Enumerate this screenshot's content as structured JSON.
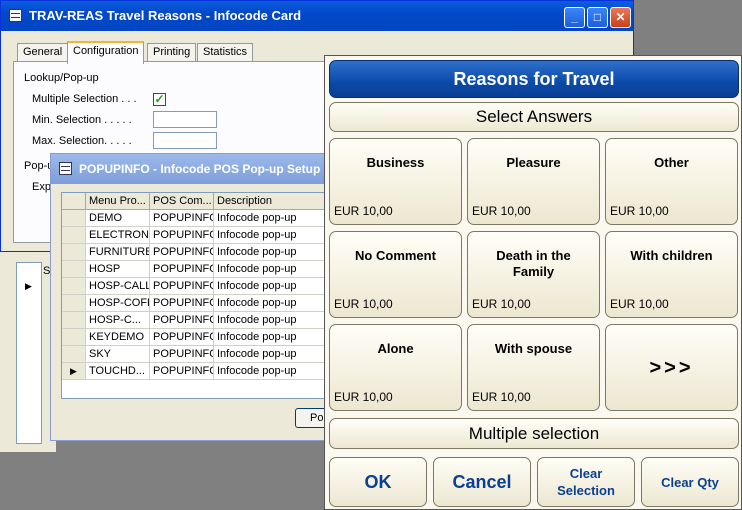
{
  "card_window": {
    "title": "TRAV-REAS Travel Reasons - Infocode Card",
    "buttons": {
      "minimize": "_",
      "maximize": "□",
      "close": "✕"
    },
    "tabs": [
      "General",
      "Configuration",
      "Printing",
      "Statistics"
    ],
    "section_lookup": "Lookup/Pop-up",
    "multiple_selection_label": "Multiple Selection . . .",
    "multiple_selection_checked": true,
    "min_selection_label": "Min. Selection . . . . .",
    "max_selection_label": "Max. Selection. . . . .",
    "popup_section_partial": "Pop-u",
    "exp_partial": "Exp",
    "list_col_partial": "S"
  },
  "popup_window": {
    "title": "POPUPINFO - Infocode POS Pop-up Setup",
    "columns": [
      "Menu Pro...",
      "POS Com...",
      "Description"
    ],
    "rows": [
      [
        "DEMO",
        "POPUPINFO",
        "Infocode pop-up"
      ],
      [
        "ELECTRON",
        "POPUPINFO",
        "Infocode pop-up"
      ],
      [
        "FURNITURE",
        "POPUPINFO",
        "Infocode pop-up"
      ],
      [
        "HOSP",
        "POPUPINFO",
        "Infocode pop-up"
      ],
      [
        "HOSP-CALL",
        "POPUPINFO",
        "Infocode pop-up"
      ],
      [
        "HOSP-COFF",
        "POPUPINFO",
        "Infocode pop-up"
      ],
      [
        "HOSP-C...",
        "POPUPINFO",
        "Infocode pop-up"
      ],
      [
        "KEYDEMO",
        "POPUPINFO",
        "Infocode pop-up"
      ],
      [
        "SKY",
        "POPUPINFO",
        "Infocode pop-up"
      ],
      [
        "TOUCHD...",
        "POPUPINFO",
        "Infocode pop-up"
      ]
    ],
    "button_partial": "Po"
  },
  "pos_panel": {
    "title": "Reasons for Travel",
    "subtitle": "Select Answers",
    "options": [
      {
        "name": "Business",
        "price": "EUR 10,00"
      },
      {
        "name": "Pleasure",
        "price": "EUR 10,00"
      },
      {
        "name": "Other",
        "price": "EUR 10,00"
      },
      {
        "name": "No Comment",
        "price": "EUR 10,00"
      },
      {
        "name": "Death in the Family",
        "price": "EUR 10,00"
      },
      {
        "name": "With children",
        "price": "EUR 10,00"
      },
      {
        "name": "Alone",
        "price": "EUR 10,00"
      },
      {
        "name": "With spouse",
        "price": "EUR 10,00"
      }
    ],
    "more_label": ">>>",
    "multiple_selection": "Multiple selection",
    "buttons": {
      "ok": "OK",
      "cancel": "Cancel",
      "clear_selection": "Clear Selection",
      "clear_qty": "Clear Qty"
    }
  },
  "colors": {
    "title_blue": "#0b4aa8",
    "button_text": "#0b3f8f",
    "panel_bg": "#fbf9ef"
  }
}
